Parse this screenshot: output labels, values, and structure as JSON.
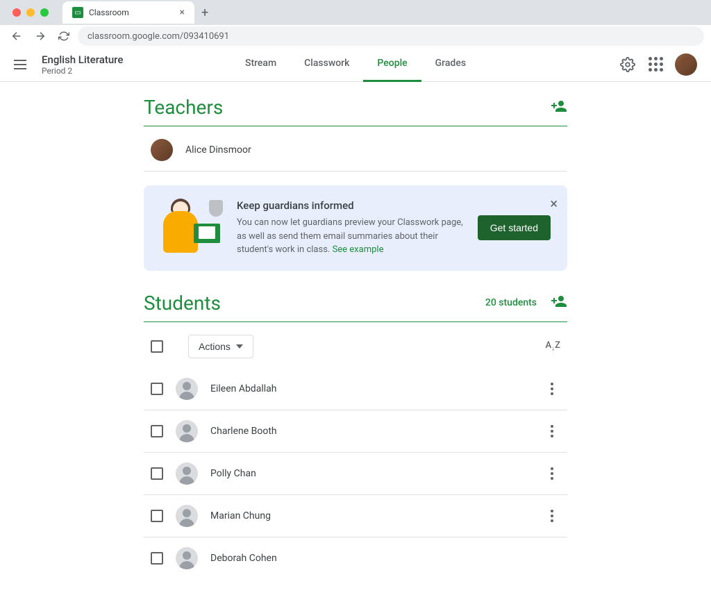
{
  "browser": {
    "tab_title": "Classroom",
    "url": "classroom.google.com/093410691"
  },
  "header": {
    "class_name": "English Literature",
    "class_sub": "Period 2",
    "tabs": [
      "Stream",
      "Classwork",
      "People",
      "Grades"
    ],
    "active_tab": "People"
  },
  "teachers": {
    "title": "Teachers",
    "list": [
      {
        "name": "Alice Dinsmoor",
        "has_photo": true
      }
    ]
  },
  "banner": {
    "title": "Keep guardians informed",
    "body": "You can now let guardians preview your Classwork page, as well as send them email summaries about their student's work in class. ",
    "link_text": "See example",
    "button": "Get started"
  },
  "students": {
    "title": "Students",
    "count_text": "20 students",
    "actions_label": "Actions",
    "list": [
      {
        "name": "Eileen Abdallah"
      },
      {
        "name": "Charlene Booth"
      },
      {
        "name": "Polly Chan"
      },
      {
        "name": "Marian Chung"
      },
      {
        "name": "Deborah Cohen"
      }
    ]
  }
}
